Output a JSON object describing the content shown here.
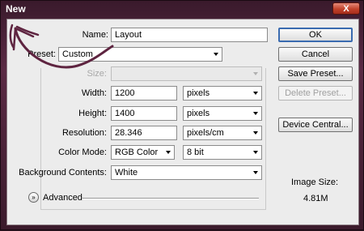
{
  "window": {
    "title": "New",
    "close_label": "X"
  },
  "form": {
    "name": {
      "label": "Name:",
      "value": "Layout"
    },
    "preset": {
      "label": "Preset:",
      "value": "Custom"
    },
    "size": {
      "label": "Size:",
      "value": ""
    },
    "width": {
      "label": "Width:",
      "value": "1200",
      "unit": "pixels"
    },
    "height": {
      "label": "Height:",
      "value": "1400",
      "unit": "pixels"
    },
    "resolution": {
      "label": "Resolution:",
      "value": "28.346",
      "unit": "pixels/cm"
    },
    "color_mode": {
      "label": "Color Mode:",
      "value": "RGB Color",
      "depth": "8 bit"
    },
    "background": {
      "label": "Background Contents:",
      "value": "White"
    },
    "advanced": {
      "label": "Advanced"
    }
  },
  "buttons": {
    "ok": "OK",
    "cancel": "Cancel",
    "save_preset": "Save Preset...",
    "delete_preset": "Delete Preset...",
    "device_central": "Device Central..."
  },
  "image_size": {
    "label": "Image Size:",
    "value": "4.81M"
  },
  "colors": {
    "accent": "#3a6bb0",
    "annotation_arrow": "#5e2440"
  }
}
